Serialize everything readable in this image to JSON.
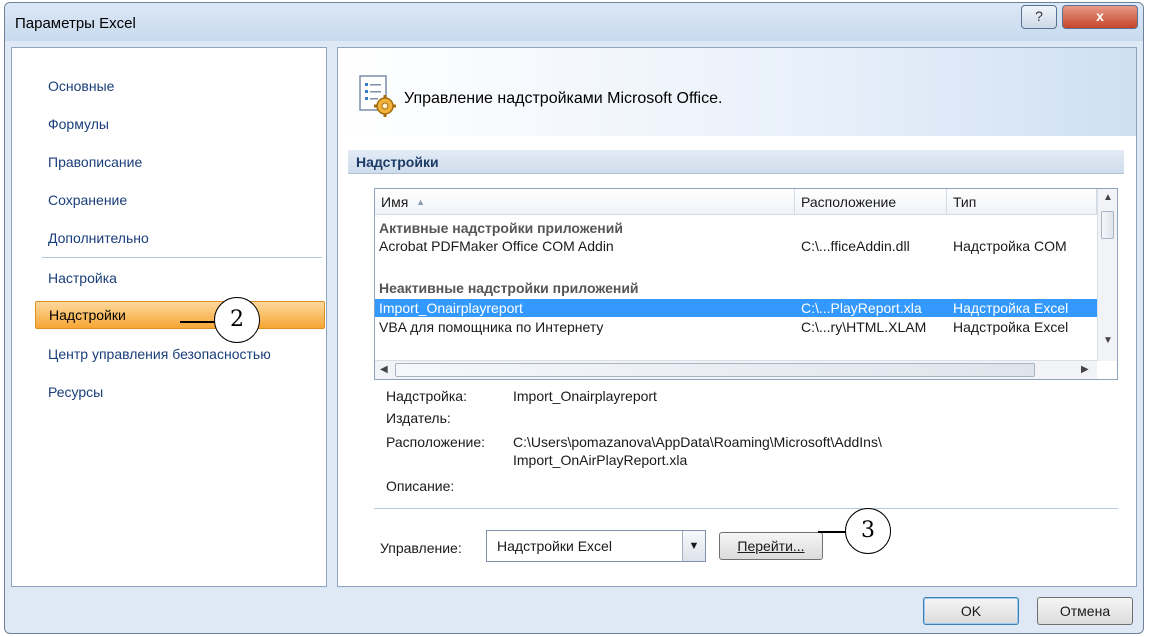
{
  "window": {
    "title": "Параметры Excel",
    "help_glyph": "?",
    "close_glyph": "x"
  },
  "nav": {
    "items": [
      {
        "label": "Основные"
      },
      {
        "label": "Формулы"
      },
      {
        "label": "Правописание"
      },
      {
        "label": "Сохранение"
      },
      {
        "label": "Дополнительно"
      },
      {
        "label": "Настройка"
      },
      {
        "label": "Надстройки",
        "selected": true
      },
      {
        "label": "Центр управления безопасностью"
      },
      {
        "label": "Ресурсы"
      }
    ]
  },
  "main": {
    "header_title": "Управление надстройками Microsoft Office.",
    "section_title": "Надстройки",
    "table": {
      "columns": [
        "Имя",
        "Расположение",
        "Тип"
      ],
      "sort_glyph": "▲",
      "groups": [
        {
          "title": "Активные надстройки приложений",
          "rows": [
            {
              "name": "Acrobat PDFMaker Office COM Addin",
              "location": "C:\\...fficeAddin.dll",
              "type": "Надстройка COM"
            }
          ]
        },
        {
          "title": "Неактивные надстройки приложений",
          "rows": [
            {
              "name": "Import_Onairplayreport",
              "location": "C:\\...PlayReport.xla",
              "type": "Надстройка Excel",
              "selected": true
            },
            {
              "name": "VBA для помощника по Интернету",
              "location": "C:\\...ry\\HTML.XLAM",
              "type": "Надстройка Excel"
            }
          ]
        }
      ]
    },
    "details": {
      "addin_label": "Надстройка:",
      "addin_value": "Import_Onairplayreport",
      "publisher_label": "Издатель:",
      "publisher_value": "",
      "location_label": "Расположение:",
      "location_value_line1": "C:\\Users\\pomazanova\\AppData\\Roaming\\Microsoft\\AddIns\\",
      "location_value_line2": "Import_OnAirPlayReport.xla",
      "description_label": "Описание:",
      "description_value": ""
    },
    "manage": {
      "label": "Управление:",
      "selected": "Надстройки Excel",
      "go_button": "Перейти..."
    }
  },
  "callouts": {
    "nav": "2",
    "go": "3"
  },
  "footer": {
    "ok": "OK",
    "cancel": "Отмена"
  },
  "colors": {
    "selection": "#3399ff",
    "nav_selected": "#f7a635",
    "link_text": "#1a3e7a"
  }
}
